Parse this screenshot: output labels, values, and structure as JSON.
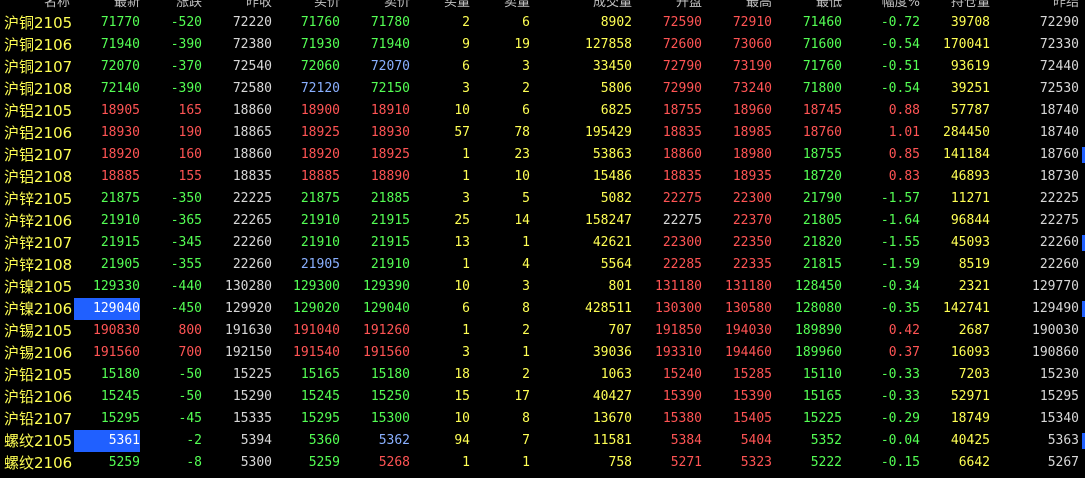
{
  "colors": {
    "background": "#000000",
    "up": "#ff5454",
    "down": "#54ff54",
    "flat": "#d8d8d8",
    "name": "#ffff54",
    "special": "#8ab0ff",
    "highlight": "#2060ff"
  },
  "header": {
    "name": "名称",
    "last": "最新",
    "change": "涨跌",
    "prev_close": "昨收",
    "bid": "买价",
    "ask": "卖价",
    "bid_vol": "买量",
    "ask_vol": "卖量",
    "volume": "成交量",
    "open": "开盘",
    "high": "最高",
    "low": "最低",
    "pct": "幅度%",
    "open_interest": "持仓量",
    "prev_settle": "昨结"
  },
  "rows": [
    {
      "name": "沪铜2105",
      "last": "71770",
      "change": "-520",
      "prev_close": "72220",
      "bid": "71760",
      "ask": "71780",
      "bid_vol": "2",
      "ask_vol": "6",
      "volume": "8902",
      "open": "72590",
      "high": "72910",
      "low": "71460",
      "pct": "-0.72",
      "open_interest": "39708",
      "prev_settle": "72290"
    },
    {
      "name": "沪铜2106",
      "last": "71940",
      "change": "-390",
      "prev_close": "72380",
      "bid": "71930",
      "ask": "71940",
      "bid_vol": "9",
      "ask_vol": "19",
      "volume": "127858",
      "open": "72600",
      "high": "73060",
      "low": "71600",
      "pct": "-0.54",
      "open_interest": "170041",
      "prev_settle": "72330"
    },
    {
      "name": "沪铜2107",
      "last": "72070",
      "change": "-370",
      "prev_close": "72540",
      "bid": "72060",
      "ask": "72070",
      "bid_vol": "6",
      "ask_vol": "3",
      "volume": "33450",
      "open": "72790",
      "high": "73190",
      "low": "71760",
      "pct": "-0.51",
      "open_interest": "93619",
      "prev_settle": "72440"
    },
    {
      "name": "沪铜2108",
      "last": "72140",
      "change": "-390",
      "prev_close": "72580",
      "bid": "72120",
      "ask": "72150",
      "bid_vol": "3",
      "ask_vol": "2",
      "volume": "5806",
      "open": "72990",
      "high": "73240",
      "low": "71800",
      "pct": "-0.54",
      "open_interest": "39251",
      "prev_settle": "72530"
    },
    {
      "name": "沪铝2105",
      "last": "18905",
      "change": "165",
      "prev_close": "18860",
      "bid": "18900",
      "ask": "18910",
      "bid_vol": "10",
      "ask_vol": "6",
      "volume": "6825",
      "open": "18755",
      "high": "18960",
      "low": "18745",
      "pct": "0.88",
      "open_interest": "57787",
      "prev_settle": "18740"
    },
    {
      "name": "沪铝2106",
      "last": "18930",
      "change": "190",
      "prev_close": "18865",
      "bid": "18925",
      "ask": "18930",
      "bid_vol": "57",
      "ask_vol": "78",
      "volume": "195429",
      "open": "18835",
      "high": "18985",
      "low": "18760",
      "pct": "1.01",
      "open_interest": "284450",
      "prev_settle": "18740"
    },
    {
      "name": "沪铝2107",
      "last": "18920",
      "change": "160",
      "prev_close": "18860",
      "bid": "18920",
      "ask": "18925",
      "bid_vol": "1",
      "ask_vol": "23",
      "volume": "53863",
      "open": "18860",
      "high": "18980",
      "low": "18755",
      "pct": "0.85",
      "open_interest": "141184",
      "prev_settle": "18760"
    },
    {
      "name": "沪铝2108",
      "last": "18885",
      "change": "155",
      "prev_close": "18835",
      "bid": "18885",
      "ask": "18890",
      "bid_vol": "1",
      "ask_vol": "10",
      "volume": "15486",
      "open": "18835",
      "high": "18935",
      "low": "18720",
      "pct": "0.83",
      "open_interest": "46893",
      "prev_settle": "18730"
    },
    {
      "name": "沪锌2105",
      "last": "21875",
      "change": "-350",
      "prev_close": "22225",
      "bid": "21875",
      "ask": "21885",
      "bid_vol": "3",
      "ask_vol": "5",
      "volume": "5082",
      "open": "22275",
      "high": "22300",
      "low": "21790",
      "pct": "-1.57",
      "open_interest": "11271",
      "prev_settle": "22225"
    },
    {
      "name": "沪锌2106",
      "last": "21910",
      "change": "-365",
      "prev_close": "22265",
      "bid": "21910",
      "ask": "21915",
      "bid_vol": "25",
      "ask_vol": "14",
      "volume": "158247",
      "open": "22275",
      "high": "22370",
      "low": "21805",
      "pct": "-1.64",
      "open_interest": "96844",
      "prev_settle": "22275"
    },
    {
      "name": "沪锌2107",
      "last": "21915",
      "change": "-345",
      "prev_close": "22260",
      "bid": "21910",
      "ask": "21915",
      "bid_vol": "13",
      "ask_vol": "1",
      "volume": "42621",
      "open": "22300",
      "high": "22350",
      "low": "21820",
      "pct": "-1.55",
      "open_interest": "45093",
      "prev_settle": "22260"
    },
    {
      "name": "沪锌2108",
      "last": "21905",
      "change": "-355",
      "prev_close": "22260",
      "bid": "21905",
      "ask": "21910",
      "bid_vol": "1",
      "ask_vol": "4",
      "volume": "5564",
      "open": "22285",
      "high": "22335",
      "low": "21815",
      "pct": "-1.59",
      "open_interest": "8519",
      "prev_settle": "22260"
    },
    {
      "name": "沪镍2105",
      "last": "129330",
      "change": "-440",
      "prev_close": "130280",
      "bid": "129300",
      "ask": "129390",
      "bid_vol": "10",
      "ask_vol": "3",
      "volume": "801",
      "open": "131180",
      "high": "131180",
      "low": "128450",
      "pct": "-0.34",
      "open_interest": "2321",
      "prev_settle": "129770"
    },
    {
      "name": "沪镍2106",
      "last": "129040",
      "change": "-450",
      "prev_close": "129920",
      "bid": "129020",
      "ask": "129040",
      "bid_vol": "6",
      "ask_vol": "8",
      "volume": "428511",
      "open": "130300",
      "high": "130580",
      "low": "128080",
      "pct": "-0.35",
      "open_interest": "142741",
      "prev_settle": "129490"
    },
    {
      "name": "沪锡2105",
      "last": "190830",
      "change": "800",
      "prev_close": "191630",
      "bid": "191040",
      "ask": "191260",
      "bid_vol": "1",
      "ask_vol": "2",
      "volume": "707",
      "open": "191850",
      "high": "194030",
      "low": "189890",
      "pct": "0.42",
      "open_interest": "2687",
      "prev_settle": "190030"
    },
    {
      "name": "沪锡2106",
      "last": "191560",
      "change": "700",
      "prev_close": "192150",
      "bid": "191540",
      "ask": "191560",
      "bid_vol": "3",
      "ask_vol": "1",
      "volume": "39036",
      "open": "193310",
      "high": "194460",
      "low": "189960",
      "pct": "0.37",
      "open_interest": "16093",
      "prev_settle": "190860"
    },
    {
      "name": "沪铅2105",
      "last": "15180",
      "change": "-50",
      "prev_close": "15225",
      "bid": "15165",
      "ask": "15180",
      "bid_vol": "18",
      "ask_vol": "2",
      "volume": "1063",
      "open": "15240",
      "high": "15285",
      "low": "15110",
      "pct": "-0.33",
      "open_interest": "7203",
      "prev_settle": "15230"
    },
    {
      "name": "沪铅2106",
      "last": "15245",
      "change": "-50",
      "prev_close": "15290",
      "bid": "15245",
      "ask": "15250",
      "bid_vol": "15",
      "ask_vol": "17",
      "volume": "40427",
      "open": "15390",
      "high": "15390",
      "low": "15165",
      "pct": "-0.33",
      "open_interest": "52971",
      "prev_settle": "15295"
    },
    {
      "name": "沪铅2107",
      "last": "15295",
      "change": "-45",
      "prev_close": "15335",
      "bid": "15295",
      "ask": "15300",
      "bid_vol": "10",
      "ask_vol": "8",
      "volume": "13670",
      "open": "15380",
      "high": "15405",
      "low": "15225",
      "pct": "-0.29",
      "open_interest": "18749",
      "prev_settle": "15340"
    },
    {
      "name": "螺纹2105",
      "last": "5361",
      "change": "-2",
      "prev_close": "5394",
      "bid": "5360",
      "ask": "5362",
      "bid_vol": "94",
      "ask_vol": "7",
      "volume": "11581",
      "open": "5384",
      "high": "5404",
      "low": "5352",
      "pct": "-0.04",
      "open_interest": "40425",
      "prev_settle": "5363"
    },
    {
      "name": "螺纹2106",
      "last": "5259",
      "change": "-8",
      "prev_close": "5300",
      "bid": "5259",
      "ask": "5268",
      "bid_vol": "1",
      "ask_vol": "1",
      "volume": "758",
      "open": "5271",
      "high": "5323",
      "low": "5222",
      "pct": "-0.15",
      "open_interest": "6642",
      "prev_settle": "5267"
    }
  ]
}
